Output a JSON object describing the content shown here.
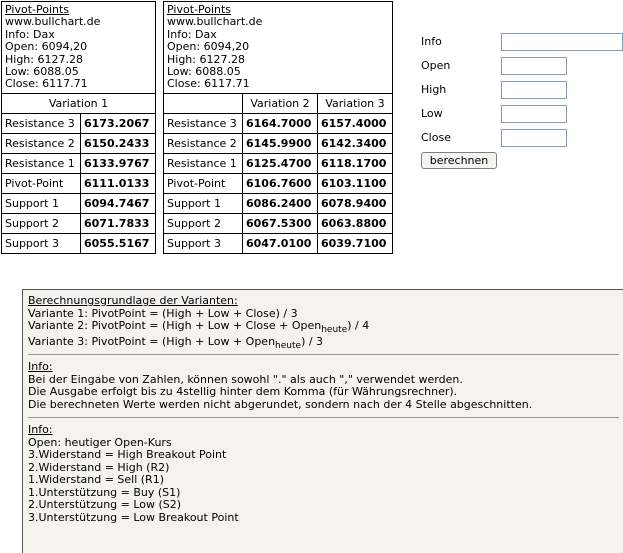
{
  "panel1": {
    "title": "Pivot-Points",
    "lines": [
      "www.bullchart.de",
      "Info: Dax",
      "Open: 6094,20",
      "High: 6127.28",
      "Low: 6088.05",
      "Close: 6117.71"
    ],
    "column_header": "Variation 1",
    "rows": [
      {
        "label": "Resistance 3",
        "v1": "6173.2067"
      },
      {
        "label": "Resistance 2",
        "v1": "6150.2433"
      },
      {
        "label": "Resistance 1",
        "v1": "6133.9767"
      },
      {
        "label": "Pivot-Point",
        "v1": "6111.0133"
      },
      {
        "label": "Support 1",
        "v1": "6094.7467"
      },
      {
        "label": "Support 2",
        "v1": "6071.7833"
      },
      {
        "label": "Support 3",
        "v1": "6055.5167"
      }
    ]
  },
  "panel2": {
    "title": "Pivot-Points",
    "lines": [
      "www.bullchart.de",
      "Info: Dax",
      "Open: 6094,20",
      "High: 6127.28",
      "Low: 6088.05",
      "Close: 6117.71"
    ],
    "column_headers": [
      "Variation 2",
      "Variation 3"
    ],
    "rows": [
      {
        "label": "Resistance 3",
        "v2": "6164.7000",
        "v3": "6157.4000"
      },
      {
        "label": "Resistance 2",
        "v2": "6145.9900",
        "v3": "6142.3400"
      },
      {
        "label": "Resistance 1",
        "v2": "6125.4700",
        "v3": "6118.1700"
      },
      {
        "label": "Pivot-Point",
        "v2": "6106.7600",
        "v3": "6103.1100"
      },
      {
        "label": "Support 1",
        "v2": "6086.2400",
        "v3": "6078.9400"
      },
      {
        "label": "Support 2",
        "v2": "6067.5300",
        "v3": "6063.8800"
      },
      {
        "label": "Support 3",
        "v2": "6047.0100",
        "v3": "6039.7100"
      }
    ]
  },
  "form": {
    "fields": [
      {
        "label": "Info",
        "value": ""
      },
      {
        "label": "Open",
        "value": ""
      },
      {
        "label": "High",
        "value": ""
      },
      {
        "label": "Low",
        "value": ""
      },
      {
        "label": "Close",
        "value": ""
      }
    ],
    "button_label": "berechnen"
  },
  "notes": {
    "basis_title": "Berechnungsgrundlage der Varianten:",
    "v1": "Variante 1: PivotPoint = (High + Low + Close) / 3",
    "v2_pre": "Variante 2: PivotPoint = (High + Low + Close + Open",
    "v2_sub": "heute",
    "v2_post": ") / 4",
    "v3_pre": "Variante 3: PivotPoint = (High + Low + Open",
    "v3_sub": "heute",
    "v3_post": ") / 3",
    "info1_title": "Info:",
    "info1_lines": [
      "Bei der Eingabe von Zahlen, können sowohl \".\" als auch \",\" verwendet werden.",
      "Die Ausgabe erfolgt bis zu 4stellig hinter dem Komma (für Währungsrechner).",
      "Die berechneten Werte werden nicht abgerundet, sondern nach der 4 Stelle abgeschnitten."
    ],
    "info2_title": "Info:",
    "info2_lines": [
      "Open: heutiger Open-Kurs",
      "3.Widerstand = High Breakout Point",
      "2.Widerstand = High (R2)",
      "1.Widerstand = Sell (R1)",
      "1.Unterstützung = Buy (S1)",
      "2.Unterstützung = Low (S2)",
      "3.Unterstützung = Low Breakout Point"
    ]
  }
}
